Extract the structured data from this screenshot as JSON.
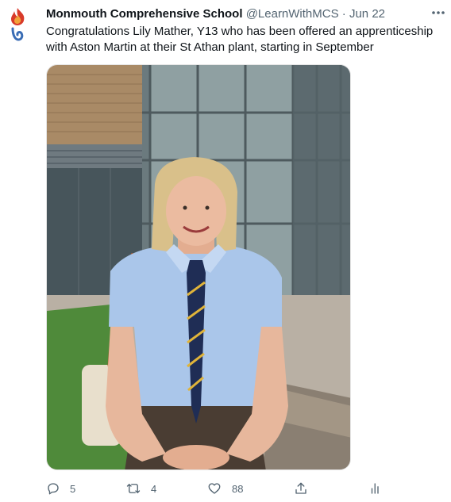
{
  "tweet": {
    "author_name": "Monmouth Comprehensive School",
    "handle": "@LearnWithMCS",
    "separator": "·",
    "date": "Jun 22",
    "text": "Congratulations Lily Mather, Y13 who has been offered an apprenticeship with Aston Martin at their St Athan plant, starting in September"
  },
  "actions": {
    "reply_count": "5",
    "retweet_count": "4",
    "like_count": "88"
  },
  "icons": {
    "avatar": "school-logo-flame",
    "more": "more-horizontal-icon",
    "reply": "reply-icon",
    "retweet": "retweet-icon",
    "like": "heart-icon",
    "share": "share-icon",
    "analytics": "analytics-icon"
  },
  "colors": {
    "text": "#0f1419",
    "muted": "#536471",
    "logo_red": "#d83a2a",
    "logo_orange": "#f2a33a",
    "logo_blue": "#3a6db5"
  }
}
